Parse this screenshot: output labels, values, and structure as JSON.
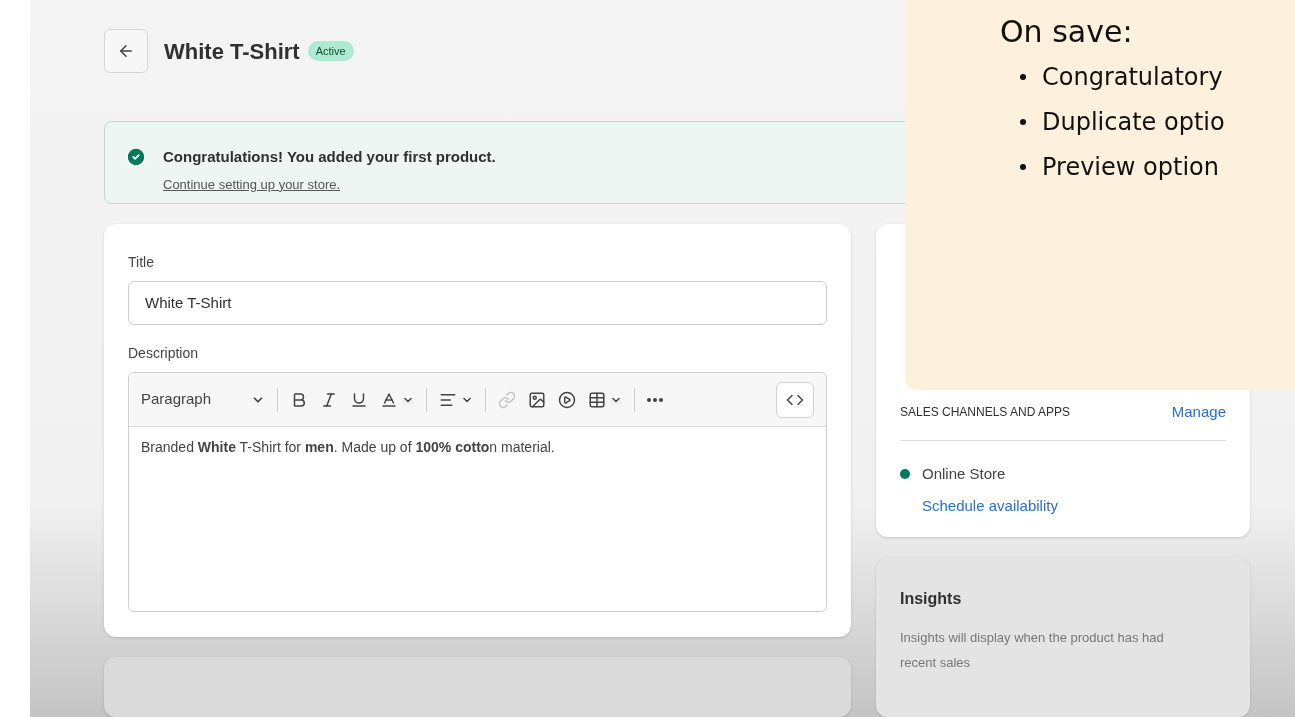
{
  "header": {
    "title": "White T-Shirt",
    "status": "Active"
  },
  "banner": {
    "message": "Congratulations! You added your first product.",
    "link": "Continue setting up your store."
  },
  "product_card": {
    "title_label": "Title",
    "title_value": "White T-Shirt",
    "description_label": "Description",
    "block_format": "Paragraph",
    "toolbar": [
      {
        "kind": "bold",
        "disabled": false
      },
      {
        "kind": "italic",
        "disabled": false
      },
      {
        "kind": "underline",
        "disabled": false
      },
      {
        "kind": "text-color",
        "disabled": false
      },
      {
        "kind": "align",
        "disabled": false
      },
      {
        "kind": "link",
        "disabled": true
      },
      {
        "kind": "image",
        "disabled": false
      },
      {
        "kind": "video",
        "disabled": false
      },
      {
        "kind": "table",
        "disabled": false
      },
      {
        "kind": "more",
        "disabled": false
      },
      {
        "kind": "code",
        "disabled": false
      }
    ],
    "description": "Branded **White** T-Shirt for **men**. Made up of **100% cotto**n material."
  },
  "sales_channels": {
    "heading": "SALES CHANNELS AND APPS",
    "action": "Manage",
    "channels": [
      {
        "name": "Online Store",
        "link": "Schedule availability",
        "color": "#007a5a"
      }
    ]
  },
  "insights": {
    "heading": "Insights",
    "text": "Insights will display when the product has had recent sales"
  },
  "note": {
    "heading": "On save:",
    "items": [
      "Congratulatory",
      "Duplicate optio",
      "Preview option"
    ]
  }
}
